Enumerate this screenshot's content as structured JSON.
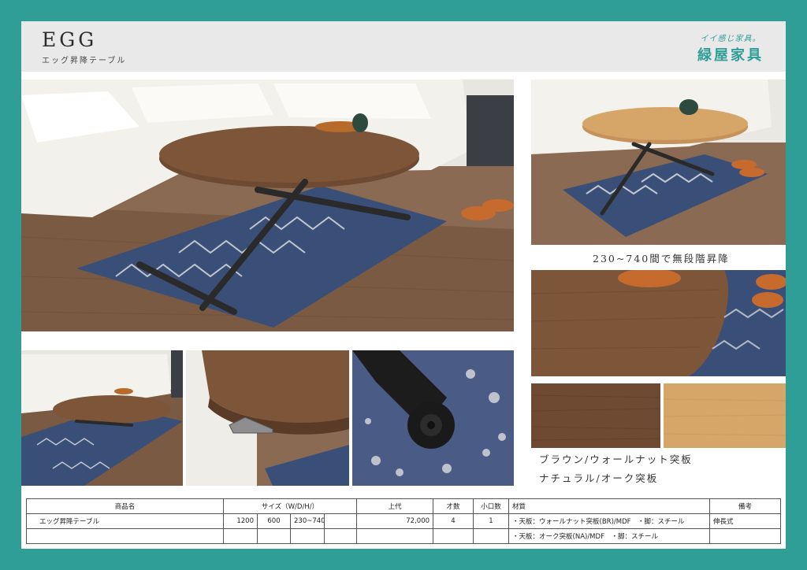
{
  "header": {
    "title": "EGG",
    "subtitle": "エッグ昇降テーブル",
    "brand_tagline": "イイ感じ家具。",
    "brand_name": "緑屋家具"
  },
  "captions": {
    "height_range": "230~740間で無段階昇降",
    "color_brown": "ブラウン/ウォールナット突板",
    "color_natural": "ナチュラル/オーク突板"
  },
  "colors": {
    "frame": "#2e9e97",
    "walnut": "#6e4a33",
    "oak": "#d6a568",
    "rug": "#3a4f78"
  },
  "table": {
    "headers": {
      "product": "商品名",
      "size": "サイズ（W/D/H/）",
      "price": "上代",
      "volume": "才数",
      "units": "小口数",
      "material": "材質",
      "notes": "備考"
    },
    "rows": [
      {
        "product": "エッグ昇降テーブル",
        "w": "1200",
        "d": "600",
        "h": "230~740",
        "price": "72,000",
        "volume": "4",
        "units": "1",
        "material": "・天板：ウォールナット突板(BR)/MDF　・脚：スチール",
        "notes": "伸長式"
      },
      {
        "product": "",
        "w": "",
        "d": "",
        "h": "",
        "price": "",
        "volume": "",
        "units": "",
        "material": "・天板：オーク突板(NA)/MDF　・脚：スチール",
        "notes": ""
      }
    ]
  }
}
